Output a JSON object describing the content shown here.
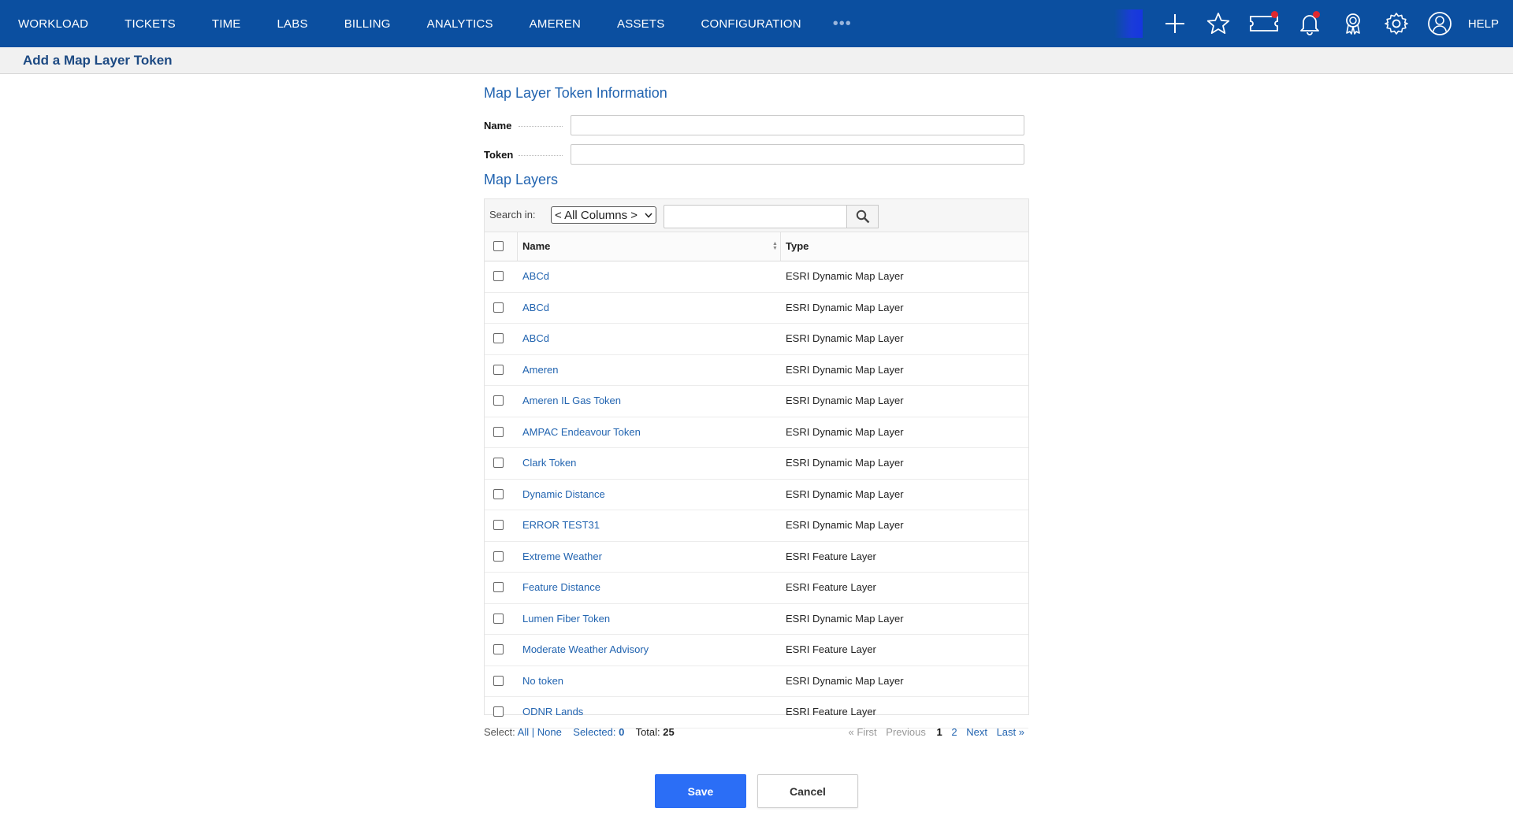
{
  "nav": {
    "items": [
      "WORKLOAD",
      "TICKETS",
      "TIME",
      "LABS",
      "BILLING",
      "ANALYTICS",
      "AMEREN",
      "ASSETS",
      "CONFIGURATION"
    ],
    "more": "•••",
    "help": "HELP",
    "icons": [
      "plus-icon",
      "star-icon",
      "ticket-icon",
      "bell-icon",
      "badge-icon",
      "gear-icon",
      "user-icon"
    ],
    "notification_dot_color": "#e0282e"
  },
  "header": {
    "title": "Add a Map Layer Token"
  },
  "form": {
    "section_title": "Map Layer Token Information",
    "name_label": "Name",
    "name_value": "",
    "token_label": "Token",
    "token_value": ""
  },
  "layers": {
    "section_title": "Map Layers",
    "search_label": "Search in:",
    "search_column": "< All Columns >",
    "search_value": "",
    "columns": [
      "Name",
      "Type"
    ],
    "rows": [
      {
        "name": "ABCd",
        "type": "ESRI Dynamic Map Layer"
      },
      {
        "name": "ABCd",
        "type": "ESRI Dynamic Map Layer"
      },
      {
        "name": "ABCd",
        "type": "ESRI Dynamic Map Layer"
      },
      {
        "name": "Ameren",
        "type": "ESRI Dynamic Map Layer"
      },
      {
        "name": "Ameren IL Gas Token",
        "type": "ESRI Dynamic Map Layer"
      },
      {
        "name": "AMPAC Endeavour Token",
        "type": "ESRI Dynamic Map Layer"
      },
      {
        "name": "Clark Token",
        "type": "ESRI Dynamic Map Layer"
      },
      {
        "name": "Dynamic Distance",
        "type": "ESRI Dynamic Map Layer"
      },
      {
        "name": "ERROR TEST31",
        "type": "ESRI Dynamic Map Layer"
      },
      {
        "name": "Extreme Weather",
        "type": "ESRI Feature Layer"
      },
      {
        "name": "Feature Distance",
        "type": "ESRI Feature Layer"
      },
      {
        "name": "Lumen Fiber Token",
        "type": "ESRI Dynamic Map Layer"
      },
      {
        "name": "Moderate Weather Advisory",
        "type": "ESRI Feature Layer"
      },
      {
        "name": "No token",
        "type": "ESRI Dynamic Map Layer"
      },
      {
        "name": "ODNR Lands",
        "type": "ESRI Feature Layer"
      }
    ]
  },
  "footer": {
    "select_label": "Select:",
    "all": "All",
    "separator": "|",
    "none": "None",
    "selected_label": "Selected:",
    "selected_count": "0",
    "total_label": "Total:",
    "total_count": "25",
    "pager": {
      "first": "« First",
      "previous": "Previous",
      "page1": "1",
      "page2": "2",
      "next": "Next",
      "last": "Last »"
    }
  },
  "buttons": {
    "save": "Save",
    "cancel": "Cancel"
  }
}
